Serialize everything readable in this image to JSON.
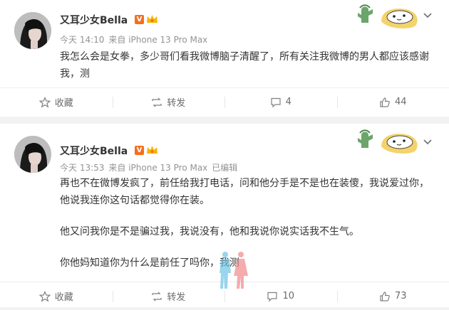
{
  "posts": [
    {
      "author": "又耳少女Bella",
      "verified_mark": "V",
      "time": "今天 14:10",
      "source": "来自 iPhone 13 Pro Max",
      "edited": "",
      "paragraphs": [
        "我怎么会是女拳，多少哥们看我微博脑子清醒了，所有关注我微博的男人都应该感谢我，测"
      ],
      "actions": {
        "favorite": "收藏",
        "repost": "转发",
        "comments": "4",
        "likes": "44"
      }
    },
    {
      "author": "又耳少女Bella",
      "verified_mark": "V",
      "time": "今天 13:53",
      "source": "来自 iPhone 13 Pro Max",
      "edited": "已编辑",
      "paragraphs": [
        "再也不在微博发疯了，前任给我打电话，问和他分手是不是也在装傻，我说爱过你，他说我连你这句话都觉得你在装。",
        "他又问我你是不是骗过我，我说没有，他和我说你说实话我不生气。",
        "你他妈知道你为什么是前任了吗你，我测"
      ],
      "actions": {
        "favorite": "收藏",
        "repost": "转发",
        "comments": "10",
        "likes": "73"
      }
    }
  ],
  "colors": {
    "accent": "#f56f1b",
    "text": "#333333",
    "muted": "#939393",
    "background": "#f2f2f2"
  },
  "icons": [
    "avatar",
    "verified-icon",
    "member-crown-icon",
    "chevron-down-icon",
    "star-icon",
    "repost-icon",
    "comment-icon",
    "thumbs-up-icon",
    "card-decoration"
  ]
}
